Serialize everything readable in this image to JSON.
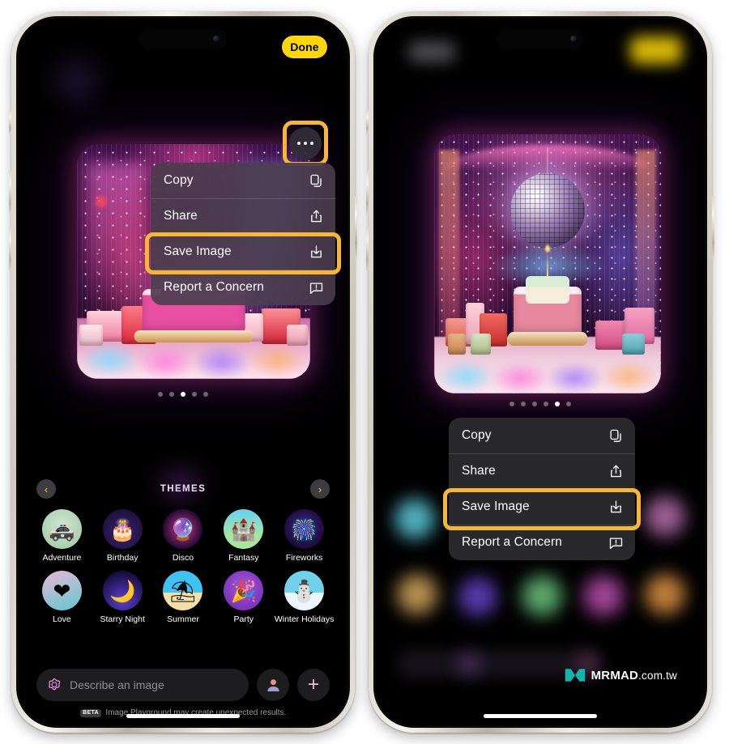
{
  "app": {
    "name": "Image Playground"
  },
  "left_phone": {
    "topbar": {
      "done_label": "Done"
    },
    "overflow_button": {
      "icon": "ellipsis-icon",
      "label": "More options"
    },
    "image_card": {
      "alt": "AI generated birthday cake on a glowing disco stage with gifts"
    },
    "page_dots": {
      "count": 5,
      "active_index": 2
    },
    "context_menu": {
      "items": [
        {
          "label": "Copy",
          "icon": "copy-icon",
          "highlighted": false
        },
        {
          "label": "Share",
          "icon": "share-icon",
          "highlighted": false
        },
        {
          "label": "Save Image",
          "icon": "save-image-icon",
          "highlighted": true
        },
        {
          "label": "Report a Concern",
          "icon": "report-concern-icon",
          "highlighted": false
        }
      ]
    },
    "themes": {
      "title": "THEMES",
      "prev_label": "‹",
      "next_label": "›",
      "items": [
        {
          "label": "Adventure",
          "glyph": "🚙",
          "bg": "#bcd8c0"
        },
        {
          "label": "Birthday",
          "glyph": "🎂",
          "bg": "#1f1440"
        },
        {
          "label": "Disco",
          "glyph": "🪩",
          "bg": "#150a2e"
        },
        {
          "label": "Fantasy",
          "glyph": "🏰",
          "bg": "#4fc3e8"
        },
        {
          "label": "Fireworks",
          "glyph": "🎆",
          "bg": "#2b1457"
        },
        {
          "label": "Love",
          "glyph": "❤️",
          "bg": "#54c5c9"
        },
        {
          "label": "Starry Night",
          "glyph": "🌙",
          "bg": "#2a1f6e"
        },
        {
          "label": "Summer",
          "glyph": "⛱️",
          "bg": "#2bb6e8"
        },
        {
          "label": "Party",
          "glyph": "🎉",
          "bg": "#8a3fd4"
        },
        {
          "label": "Winter Holidays",
          "glyph": "⛄",
          "bg": "#bfe8f5"
        }
      ]
    },
    "composer": {
      "input_placeholder": "Describe an image",
      "playground_icon": "image-playground-icon",
      "person_button_icon": "person-icon",
      "add_button_icon": "plus-icon"
    },
    "footer": {
      "beta_badge": "BETA",
      "disclaimer": "Image Playground may create unexpected results."
    }
  },
  "right_phone": {
    "image_card": {
      "alt": "AI generated birthday cake under a disco ball on a sparkling stage"
    },
    "page_dots": {
      "count": 6,
      "active_index": 4
    },
    "context_menu": {
      "items": [
        {
          "label": "Copy",
          "icon": "copy-icon",
          "highlighted": false
        },
        {
          "label": "Share",
          "icon": "share-icon",
          "highlighted": false
        },
        {
          "label": "Save Image",
          "icon": "save-image-icon",
          "highlighted": true
        },
        {
          "label": "Report a Concern",
          "icon": "report-concern-icon",
          "highlighted": false
        }
      ]
    },
    "watermark": {
      "brand": "MRMAD",
      "suffix": ".com.tw",
      "logo_icon": "mrmad-logo-icon",
      "logo_color": "#12b5ab"
    }
  },
  "colors": {
    "highlight": "#F7B733",
    "accent_yellow": "#FFD60A",
    "menu_bg_left": "rgba(74,62,77,.88)",
    "menu_bg_right": "rgba(43,43,45,.95)",
    "watermark_teal": "#12b5ab"
  }
}
